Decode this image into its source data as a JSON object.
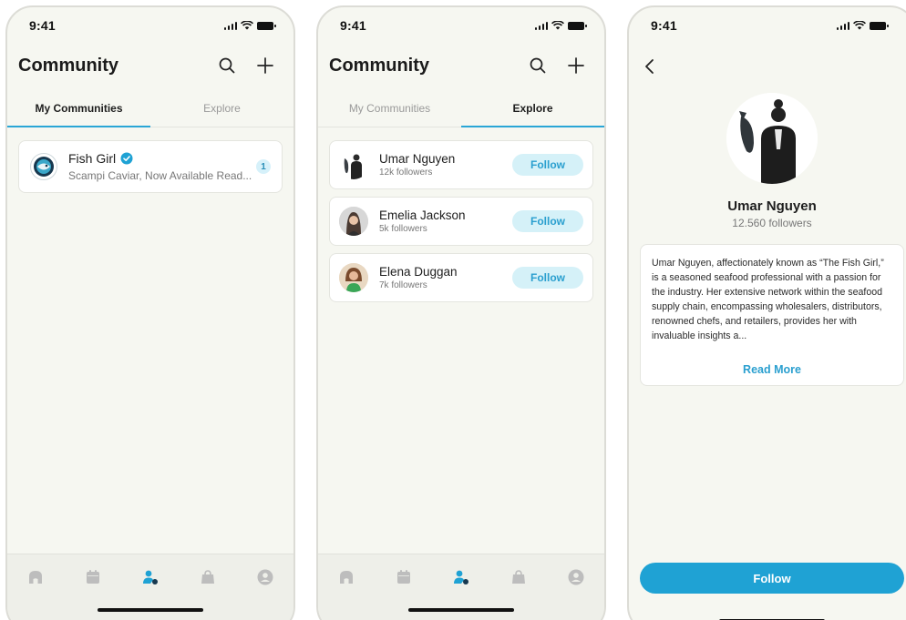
{
  "status": {
    "time": "9:41"
  },
  "screen1": {
    "header": {
      "title": "Community"
    },
    "tabs": [
      {
        "label": "My Communities"
      },
      {
        "label": "Explore"
      }
    ],
    "communities": [
      {
        "name": "Fish Girl",
        "last_message": "Scampi Caviar, Now Available Read...",
        "unread": "1",
        "verified": true
      }
    ]
  },
  "screen2": {
    "header": {
      "title": "Community"
    },
    "tabs": [
      {
        "label": "My Communities"
      },
      {
        "label": "Explore"
      }
    ],
    "users": [
      {
        "name": "Umar Nguyen",
        "followers": "12k followers",
        "button": "Follow"
      },
      {
        "name": "Emelia Jackson",
        "followers": "5k followers",
        "button": "Follow"
      },
      {
        "name": "Elena Duggan",
        "followers": "7k followers",
        "button": "Follow"
      }
    ]
  },
  "screen3": {
    "profile": {
      "name": "Umar Nguyen",
      "followers": "12.560 followers",
      "bio": "Umar Nguyen, affectionately known as “The Fish Girl,” is a seasoned seafood professional with a passion for the industry. Her extensive network within the seafood supply chain, encompassing wholesalers, distributors, renowned chefs, and retailers, provides her with invaluable insights a...",
      "read_more": "Read More",
      "follow_button": "Follow"
    }
  },
  "nav": {
    "items": [
      "home-icon",
      "calendar-icon",
      "community-icon",
      "shopping-bag-icon",
      "profile-icon"
    ],
    "active_index": 2
  },
  "colors": {
    "accent": "#1fa2d4",
    "accent_light": "#d5f1f8",
    "background": "#f6f7f1",
    "inactive_icon": "#bdbdbd"
  }
}
